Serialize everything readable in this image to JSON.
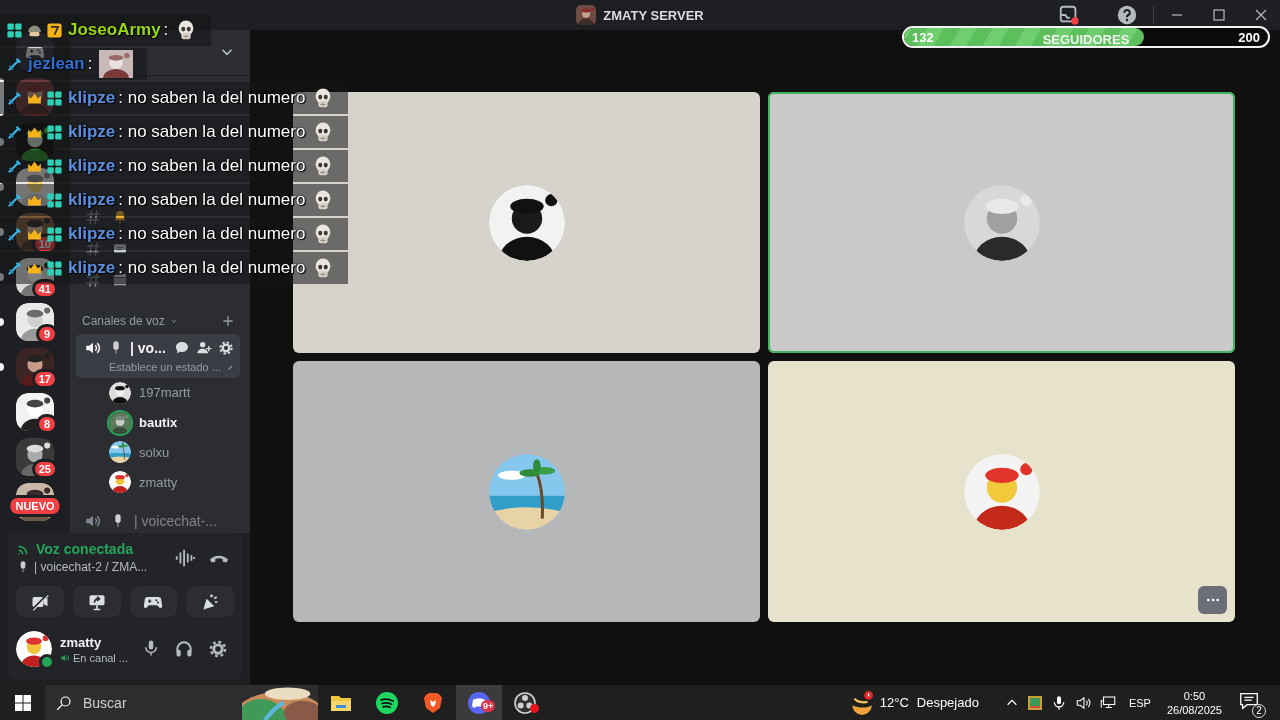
{
  "window": {
    "title": "ZMATY SERVER"
  },
  "follower_goal": {
    "current": "132",
    "label": "SEGUIDORES",
    "target": "200",
    "level": 0.66
  },
  "chat_overlay": [
    {
      "badges": [
        {
          "kind": "grid"
        },
        {
          "kind": "helmet"
        },
        {
          "kind": "seven"
        }
      ],
      "user": "JoseoArmy",
      "color": "#9ad80f",
      "message": ":",
      "emote": {
        "kind": "skull"
      }
    },
    {
      "badges": [
        {
          "kind": "sword"
        }
      ],
      "user": "jezlean",
      "color": "#2f6fd6",
      "message": ":"
    },
    {
      "badges": [
        {
          "kind": "sword"
        },
        {
          "kind": "crown"
        },
        {
          "kind": "grid"
        }
      ],
      "user": "klipze",
      "color": "#5b8ee0",
      "message": ": no saben la del numero",
      "emote": {
        "kind": "skull"
      }
    },
    {
      "badges": [
        {
          "kind": "sword"
        },
        {
          "kind": "crown"
        },
        {
          "kind": "grid"
        }
      ],
      "user": "klipze",
      "color": "#5b8ee0",
      "message": ": no saben la del numero",
      "emote": {
        "kind": "skull"
      }
    },
    {
      "badges": [
        {
          "kind": "sword"
        },
        {
          "kind": "crown"
        },
        {
          "kind": "grid"
        }
      ],
      "user": "klipze",
      "color": "#5b8ee0",
      "message": ": no saben la del numero",
      "emote": {
        "kind": "skull"
      }
    },
    {
      "badges": [
        {
          "kind": "sword"
        },
        {
          "kind": "crown"
        },
        {
          "kind": "grid"
        }
      ],
      "user": "klipze",
      "color": "#5b8ee0",
      "message": ": no saben la del numero",
      "emote": {
        "kind": "skull"
      }
    },
    {
      "badges": [
        {
          "kind": "sword"
        },
        {
          "kind": "crown"
        },
        {
          "kind": "grid"
        }
      ],
      "user": "klipze",
      "color": "#5b8ee0",
      "message": ": no saben la del numero",
      "emote": {
        "kind": "skull"
      }
    },
    {
      "badges": [
        {
          "kind": "sword"
        },
        {
          "kind": "crown"
        },
        {
          "kind": "grid"
        }
      ],
      "user": "klipze",
      "color": "#5b8ee0",
      "message": ": no saben la del numero",
      "emote": {
        "kind": "skull"
      }
    }
  ],
  "servers": [
    {
      "kind": "home",
      "selected": false,
      "unread": false
    },
    {
      "kind": "server",
      "selected": true,
      "unread": false
    },
    {
      "kind": "server",
      "selected": false,
      "unread": true
    },
    {
      "kind": "server",
      "selected": false,
      "unread": true
    },
    {
      "kind": "server",
      "selected": false,
      "unread": true,
      "badge": {
        "text": "10",
        "kind": "count"
      }
    },
    {
      "kind": "server",
      "selected": false,
      "unread": true,
      "badge": {
        "text": "41",
        "kind": "count"
      }
    },
    {
      "kind": "server",
      "selected": false,
      "unread": true,
      "badge": {
        "text": "9",
        "kind": "count"
      }
    },
    {
      "kind": "server",
      "selected": false,
      "unread": true,
      "badge": {
        "text": "17",
        "kind": "count"
      }
    },
    {
      "kind": "server",
      "selected": false,
      "unread": false,
      "badge": {
        "text": "8",
        "kind": "count"
      }
    },
    {
      "kind": "server",
      "selected": false,
      "unread": false,
      "badge": {
        "text": "25",
        "kind": "count"
      }
    },
    {
      "kind": "server",
      "selected": false,
      "unread": false,
      "badge": {
        "text": "NUEVO",
        "kind": "label"
      }
    }
  ],
  "channel_list": {
    "voice_header": "Canales de voz",
    "active_voice_channel": {
      "name": "| vo...",
      "status": "Establece un estado ..."
    },
    "members": [
      {
        "name": "197martt",
        "speaking": false
      },
      {
        "name": "bautix",
        "speaking": true
      },
      {
        "name": "solxu",
        "speaking": false
      },
      {
        "name": "zmatty",
        "speaking": false
      }
    ],
    "other_voice_channel": {
      "name": "| voicechat-..."
    }
  },
  "voice_panel": {
    "status": "Voz conectada",
    "channel": "| voicechat-2 / ZMA..."
  },
  "user_panel": {
    "name": "zmatty",
    "status": "En canal ..."
  },
  "stage": {
    "tiles": [
      {
        "color": "#d6d3cd",
        "speaking": false
      },
      {
        "color": "#c9c9c9",
        "speaking": true
      },
      {
        "color": "#b5b7b9",
        "speaking": false
      },
      {
        "color": "#e7e2cb",
        "speaking": false
      }
    ]
  },
  "taskbar": {
    "search_placeholder": "Buscar",
    "apps": [
      {
        "kind": "folder",
        "selected": false,
        "alert": false
      },
      {
        "kind": "music",
        "selected": false,
        "alert": false
      },
      {
        "kind": "browser",
        "selected": false,
        "alert": false
      },
      {
        "kind": "chat",
        "selected": true,
        "alert": false,
        "badge": "9+"
      },
      {
        "kind": "recorder",
        "selected": false,
        "alert": true
      }
    ],
    "temperature": "12°C",
    "condition": "Despejado",
    "language": "ESP",
    "time": "0:50",
    "date": "26/08/2025",
    "notifications": "2"
  }
}
